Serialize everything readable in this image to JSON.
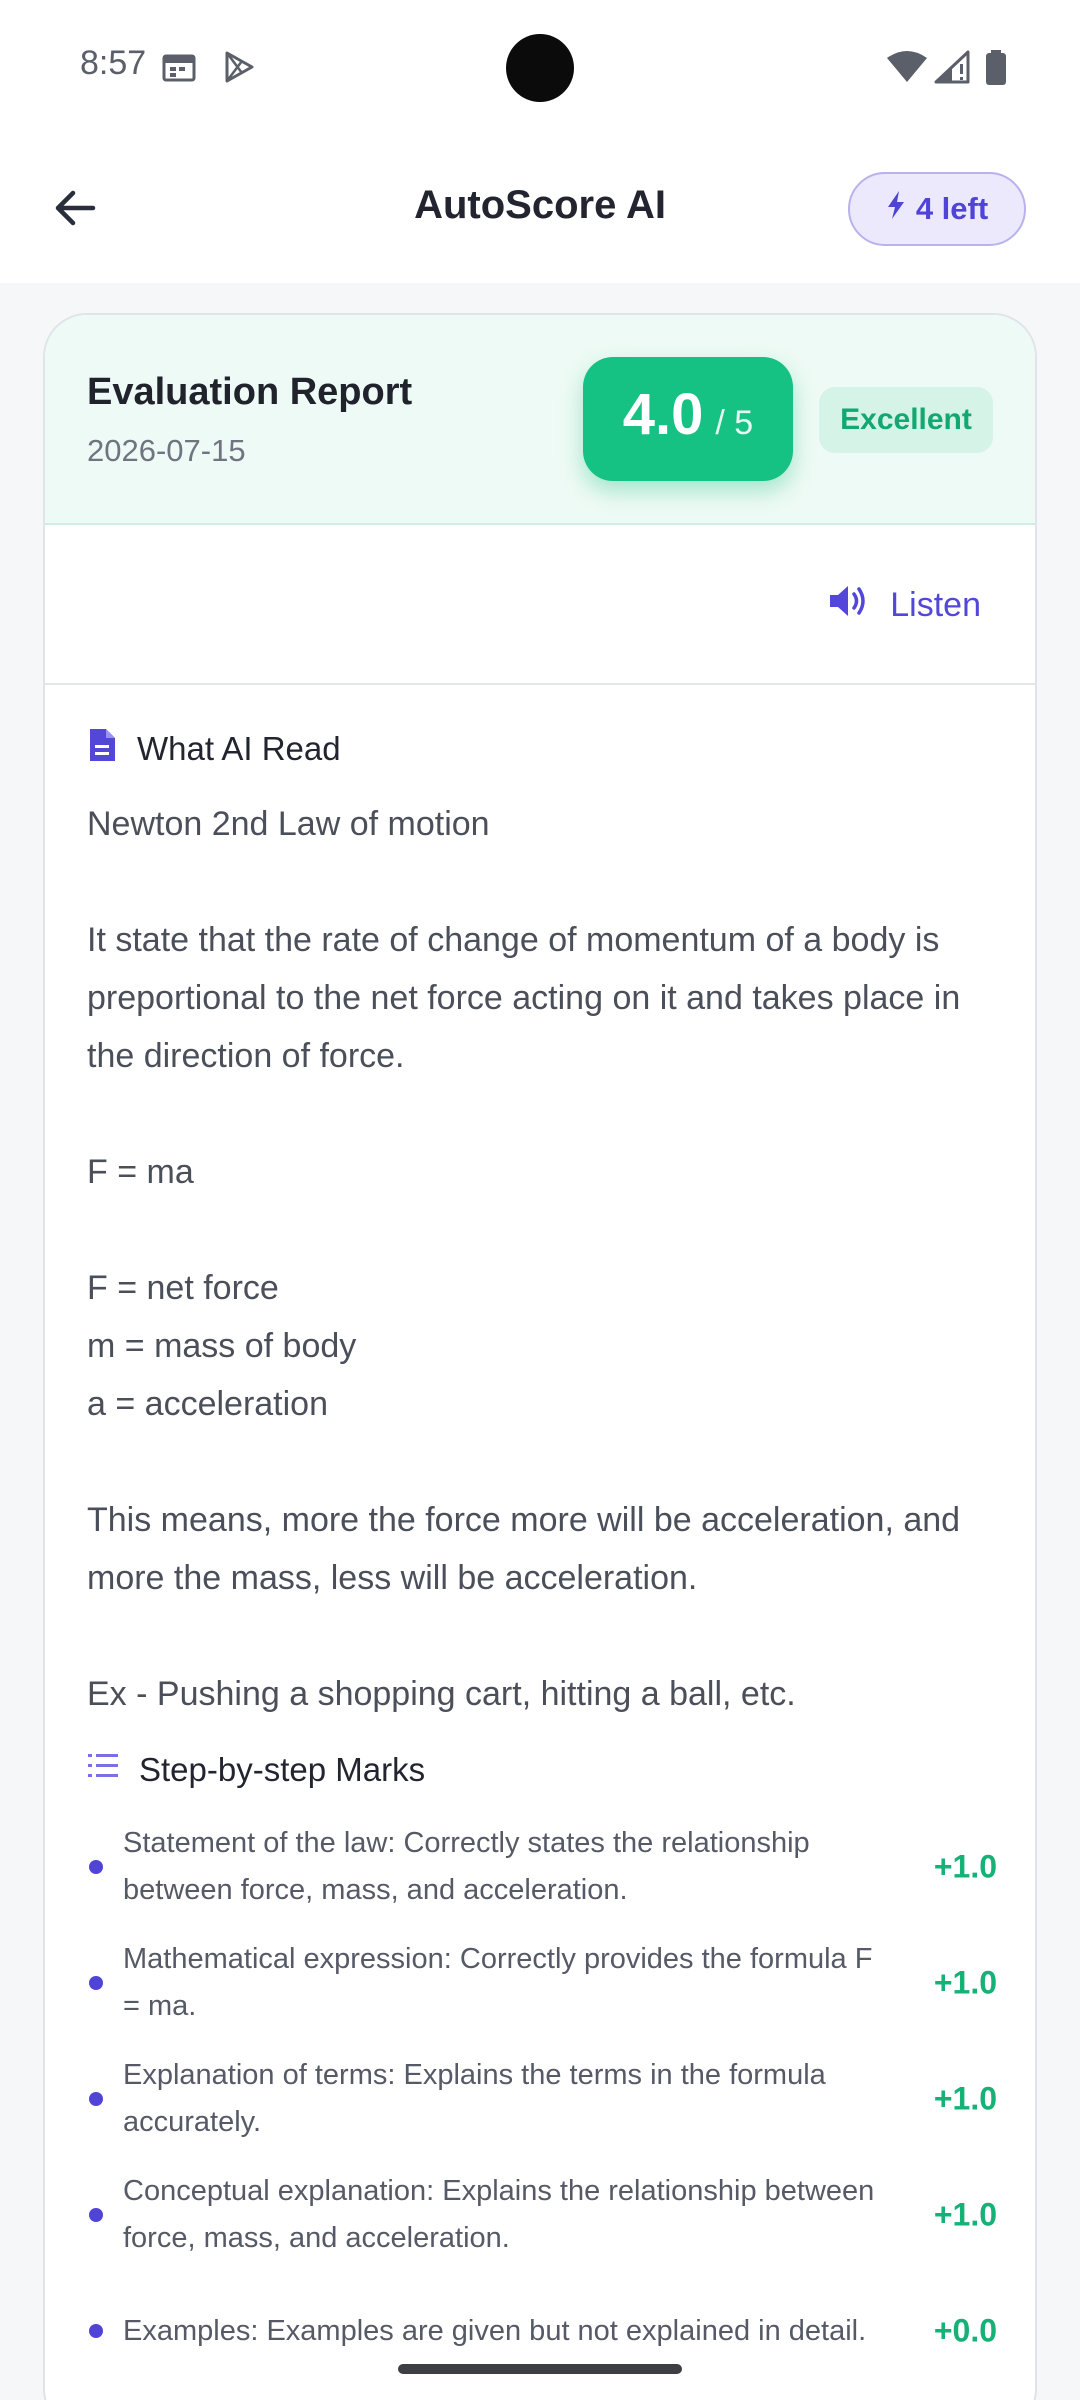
{
  "status_bar": {
    "time": "8:57",
    "icons": [
      "calendar-icon",
      "play-store-icon",
      "wifi-icon",
      "signal-icon",
      "battery-icon"
    ]
  },
  "app_bar": {
    "title": "AutoScore AI",
    "credits_label": "4 left",
    "back_icon": "arrow-left-icon",
    "credits_icon": "lightning-icon"
  },
  "report": {
    "title": "Evaluation Report",
    "date": "2026-07-15",
    "score": "4.0",
    "score_max": "/ 5",
    "grade": "Excellent",
    "listen_label": "Listen"
  },
  "ocr": {
    "heading": "What AI Read",
    "text": "Newton 2nd Law of motion\n\nIt state that the rate of change of momentum of a body is preportional to the net force acting on it and takes place in the direction of force.\n\nF = ma\n\nF = net force\nm = mass of body\na = acceleration\n\nThis means, more the force more will be acceleration, and more the mass, less will be acceleration.\n\nEx - Pushing a shopping cart, hitting a ball, etc."
  },
  "marks": {
    "heading": "Step-by-step Marks",
    "items": [
      {
        "text": "Statement of the law: Correctly states the relationship between force, mass, and acceleration.",
        "score": "+1.0"
      },
      {
        "text": "Mathematical expression: Correctly provides the formula F = ma.",
        "score": "+1.0"
      },
      {
        "text": "Explanation of terms: Explains the terms in the formula accurately.",
        "score": "+1.0"
      },
      {
        "text": "Conceptual explanation: Explains the relationship between force, mass, and acceleration.",
        "score": "+1.0"
      },
      {
        "text": "Examples: Examples are given but not explained in detail.",
        "score": "+0.0"
      }
    ]
  },
  "colors": {
    "accent": "#4f44d6",
    "success": "#16c184",
    "background": "#f6f7f9"
  }
}
